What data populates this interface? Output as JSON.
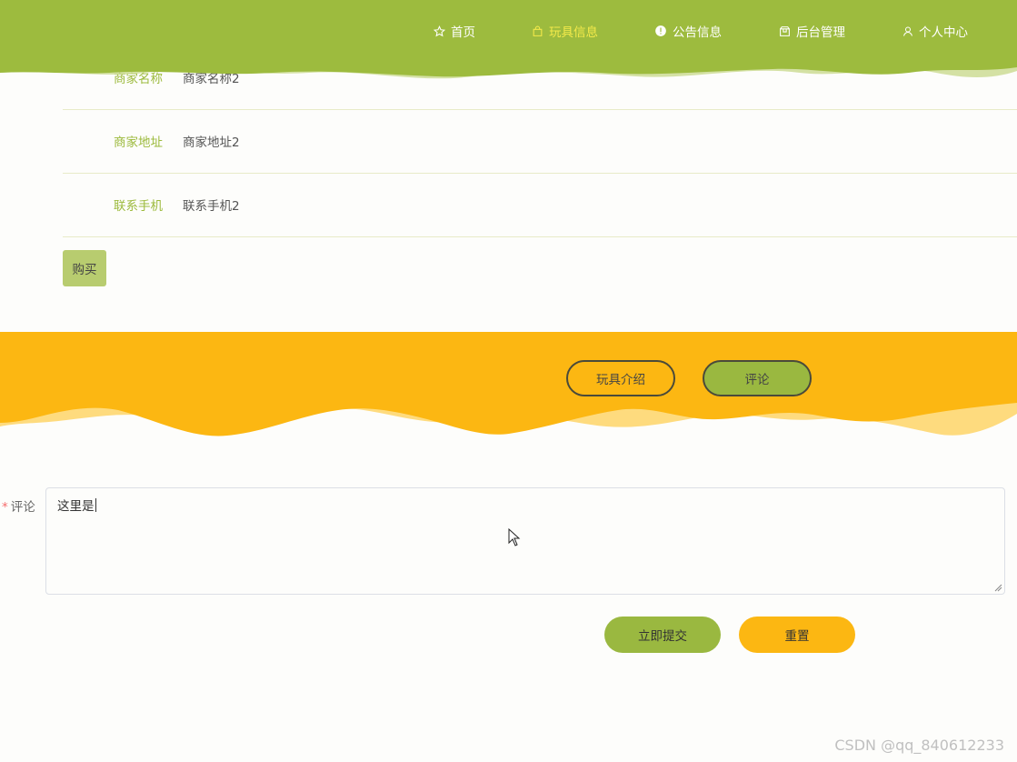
{
  "nav": {
    "items": [
      {
        "label": "首页",
        "icon": "star-icon"
      },
      {
        "label": "玩具信息",
        "icon": "bag-icon",
        "active": true
      },
      {
        "label": "公告信息",
        "icon": "info-icon"
      },
      {
        "label": "后台管理",
        "icon": "box-icon"
      },
      {
        "label": "个人中心",
        "icon": "user-icon"
      }
    ]
  },
  "details": [
    {
      "label": "商家名称",
      "value": "商家名称2"
    },
    {
      "label": "商家地址",
      "value": "商家地址2"
    },
    {
      "label": "联系手机",
      "value": "联系手机2"
    }
  ],
  "buy_label": "购买",
  "tabs": {
    "intro": "玩具介绍",
    "comment": "评论"
  },
  "form": {
    "required_mark": "*",
    "comment_label": "评论",
    "comment_value": "这里是",
    "submit_label": "立即提交",
    "reset_label": "重置"
  },
  "watermark": "CSDN @qq_840612233",
  "colors": {
    "nav_green": "#9dbb3e",
    "active_nav": "#f4ea4a",
    "band_yellow": "#fcb712",
    "button_green": "#9ab840",
    "label_green": "#9cba3c"
  }
}
